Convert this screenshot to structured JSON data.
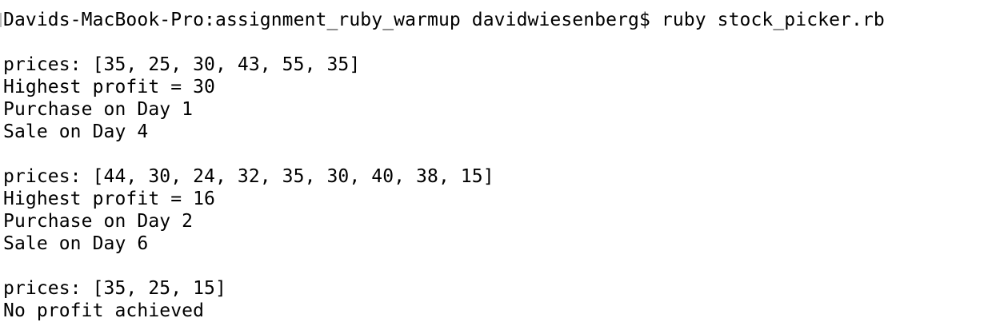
{
  "terminal": {
    "prompt": "Davids-MacBook-Pro:assignment_ruby_warmup davidwiesenberg$",
    "command": "ruby stock_picker.rb",
    "output_blocks": [
      {
        "prices": "prices: [35, 25, 30, 43, 55, 35]",
        "profit": "Highest profit = 30",
        "purchase": "Purchase on Day 1",
        "sale": "Sale on Day 4"
      },
      {
        "prices": "prices: [44, 30, 24, 32, 35, 30, 40, 38, 15]",
        "profit": "Highest profit = 16",
        "purchase": "Purchase on Day 2",
        "sale": "Sale on Day 6"
      },
      {
        "prices": "prices: [35, 25, 15]",
        "result": "No profit achieved"
      }
    ]
  }
}
